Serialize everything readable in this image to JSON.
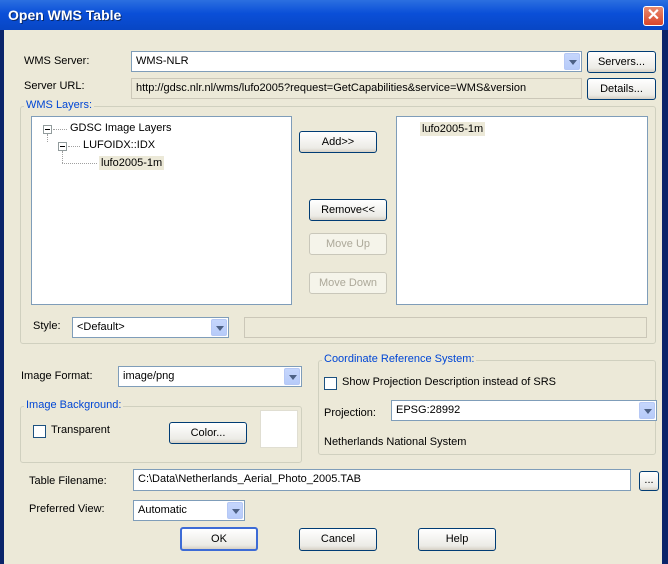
{
  "window": {
    "title": "Open WMS Table",
    "close_label": "✕"
  },
  "server": {
    "label": "WMS Server:",
    "value": "WMS-NLR",
    "servers_button": "Servers...",
    "url_label": "Server URL:",
    "url_value": "http://gdsc.nlr.nl/wms/lufo2005?request=GetCapabilities&service=WMS&version",
    "details_button": "Details..."
  },
  "layers": {
    "group_label": "WMS Layers:",
    "tree": [
      {
        "label": "GDSC Image Layers"
      },
      {
        "label": "LUFOIDX::IDX"
      },
      {
        "label": "lufo2005-1m"
      }
    ],
    "selected": [
      "lufo2005-1m"
    ],
    "add_button": "Add>>",
    "remove_button": "Remove<<",
    "move_up_button": "Move Up",
    "move_down_button": "Move Down"
  },
  "style": {
    "label": "Style:",
    "value": "<Default>"
  },
  "image_format": {
    "label": "Image Format:",
    "value": "image/png"
  },
  "background": {
    "group_label": "Image Background:",
    "transparent_label": "Transparent",
    "color_button": "Color..."
  },
  "crs": {
    "group_label": "Coordinate Reference System:",
    "show_description_label": "Show Projection Description instead of SRS",
    "projection_label": "Projection:",
    "projection_value": "EPSG:28992",
    "description": "Netherlands National System"
  },
  "table": {
    "filename_label": "Table Filename:",
    "filename_value": "C:\\Data\\Netherlands_Aerial_Photo_2005.TAB",
    "browse_button": "...",
    "preferred_view_label": "Preferred View:",
    "preferred_view_value": "Automatic"
  },
  "footer": {
    "ok": "OK",
    "cancel": "Cancel",
    "help": "Help"
  }
}
